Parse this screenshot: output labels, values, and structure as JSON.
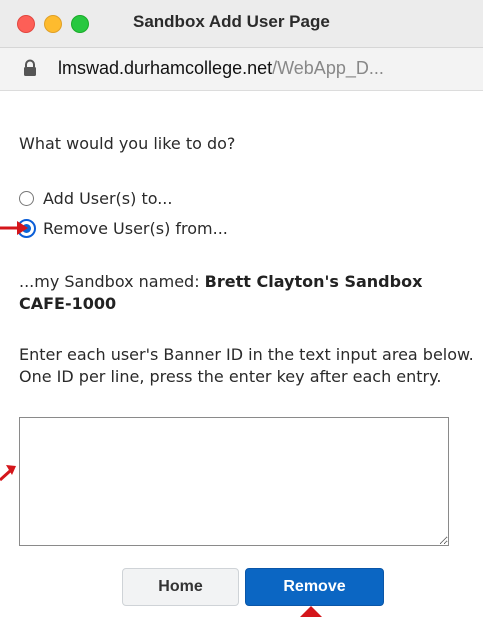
{
  "window": {
    "title": "Sandbox Add User Page"
  },
  "address_bar": {
    "host": "lmswad.durhamcollege.net",
    "path": "/WebApp_D..."
  },
  "form": {
    "question": "What would you like to do?",
    "options": [
      {
        "label": "Add User(s) to...",
        "checked": false
      },
      {
        "label": "Remove User(s) from...",
        "checked": true
      }
    ],
    "sandbox_prefix": "...my Sandbox named: ",
    "sandbox_name": "Brett Clayton's Sandbox CAFE-1000",
    "instructions": "Enter each user's Banner ID in the text input area below. One ID per line, press the enter key after each entry.",
    "ids_value": ""
  },
  "buttons": {
    "home": "Home",
    "remove": "Remove"
  },
  "colors": {
    "accent": "#0b66c3",
    "annotation_arrow": "#d4161b"
  }
}
